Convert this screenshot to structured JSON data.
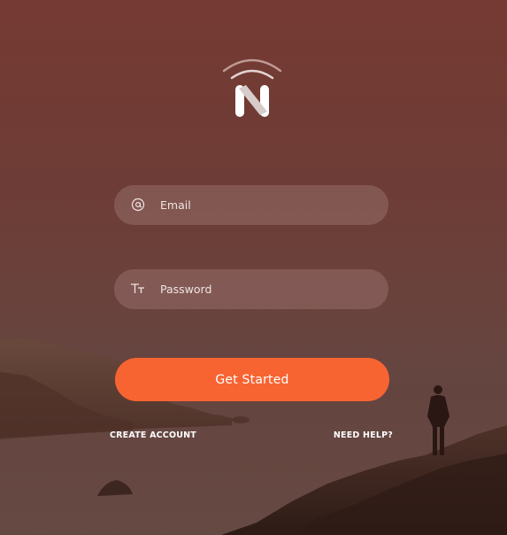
{
  "app": {
    "logo_letter": "N",
    "logo_icon": "signal-n-logo-icon"
  },
  "login_form": {
    "email": {
      "icon": "at-sign-icon",
      "placeholder": "Email",
      "value": ""
    },
    "password": {
      "icon": "text-format-icon",
      "placeholder": "Password",
      "value": ""
    },
    "submit_label": "Get Started"
  },
  "links": {
    "create_account": "CREATE ACCOUNT",
    "need_help": "NEED HELP?"
  },
  "colors": {
    "accent": "#f76432",
    "background": "#6e3c36",
    "field_background": "#966e68"
  }
}
